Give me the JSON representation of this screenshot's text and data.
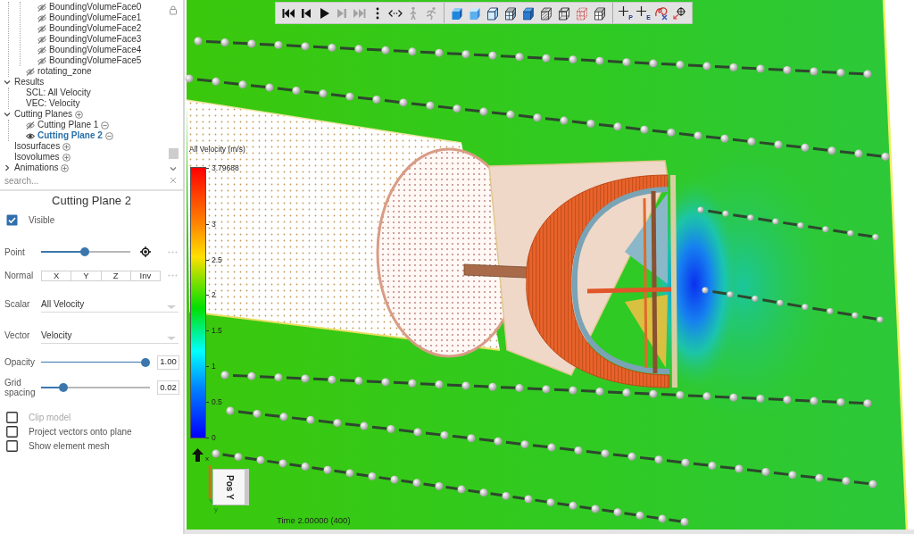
{
  "tree": {
    "items": [
      {
        "children": [
          {
            "children": [
              {
                "label": "BoundingVolumeFace0",
                "visible": false,
                "selected": false
              },
              {
                "label": "BoundingVolumeFace1",
                "visible": false,
                "selected": false
              },
              {
                "label": "BoundingVolumeFace2",
                "visible": false,
                "selected": false
              },
              {
                "label": "BoundingVolumeFace3",
                "visible": false,
                "selected": false
              },
              {
                "label": "BoundingVolumeFace4",
                "visible": false,
                "selected": false
              },
              {
                "label": "BoundingVolumeFace5",
                "visible": false,
                "selected": false
              }
            ]
          },
          {
            "label": "rotating_zone",
            "visible": false,
            "selected": false
          }
        ]
      },
      {
        "label": "Results",
        "expanded": true,
        "selected": false,
        "children": [
          {
            "label": "SCL: All Velocity",
            "selected": false
          },
          {
            "label": "VEC: Velocity",
            "selected": false
          }
        ]
      },
      {
        "label": "Cutting Planes",
        "expanded": true,
        "add_button": true,
        "selected": false,
        "children": [
          {
            "label": "Cutting Plane 1",
            "visible": false,
            "remove_button": true,
            "selected": false
          },
          {
            "label": "Cutting Plane 2",
            "visible": true,
            "remove_button": true,
            "selected": true
          }
        ]
      },
      {
        "label": "Isosurfaces",
        "add_button": true,
        "selected": false
      },
      {
        "label": "Isovolumes",
        "add_button": true,
        "selected": false
      },
      {
        "label": "Animations",
        "expanded": false,
        "add_button": true,
        "selected": false
      }
    ],
    "search": {
      "placeholder": "search..."
    }
  },
  "properties": {
    "title": "Cutting Plane 2",
    "visible": {
      "label": "Visible",
      "checked": true
    },
    "point": {
      "label": "Point",
      "level": 0.49
    },
    "normal": {
      "label": "Normal",
      "buttons": [
        "X",
        "Y",
        "Z",
        "Inv"
      ]
    },
    "scalar": {
      "label": "Scalar",
      "value": "All Velocity"
    },
    "vector": {
      "label": "Vector",
      "value": "Velocity"
    },
    "opacity": {
      "label": "Opacity",
      "level": 1,
      "value": "1.00"
    },
    "grid_spacing": {
      "label": "Grid spacing",
      "level": 0.18,
      "value": "0.02"
    },
    "options": [
      {
        "label": "Clip model",
        "checked": false,
        "disabled": true
      },
      {
        "label": "Project vectors onto plane",
        "checked": false,
        "disabled": false
      },
      {
        "label": "Show element mesh",
        "checked": false,
        "disabled": false
      }
    ]
  },
  "toolbar": {
    "groups": [
      [
        {
          "kind": "first",
          "disabled": false
        },
        {
          "kind": "previous",
          "disabled": false
        },
        {
          "kind": "play",
          "disabled": false
        },
        {
          "kind": "next",
          "disabled": true
        },
        {
          "kind": "last",
          "disabled": true
        },
        {
          "kind": "more",
          "disabled": false
        },
        {
          "kind": "bounce",
          "disabled": false
        },
        {
          "kind": "walk",
          "disabled": true
        },
        {
          "kind": "run",
          "disabled": true
        }
      ],
      [
        {
          "kind": "shaded",
          "disabled": false
        },
        {
          "kind": "smooth",
          "disabled": false
        },
        {
          "kind": "edged",
          "disabled": false
        },
        {
          "kind": "meshed",
          "disabled": false
        },
        {
          "kind": "flat",
          "disabled": false
        },
        {
          "kind": "hatched",
          "disabled": false
        },
        {
          "kind": "wire",
          "disabled": false
        },
        {
          "kind": "dashed",
          "disabled": false
        },
        {
          "kind": "grid",
          "disabled": false
        }
      ],
      [
        {
          "kind": "probe",
          "label": "P",
          "disabled": false
        },
        {
          "kind": "probe",
          "label": "E",
          "disabled": false
        },
        {
          "kind": "scribble",
          "disabled": false
        },
        {
          "kind": "center",
          "disabled": false
        }
      ]
    ]
  },
  "viewport": {
    "legend": {
      "title": "All Velocity (m/s)",
      "labels": [
        "3.79688",
        "3",
        "2.5",
        "2",
        "1.5",
        "1",
        "0.5",
        "0"
      ]
    },
    "orientation": {
      "face": "Pos Y",
      "axes": [
        "x",
        "y"
      ]
    },
    "time": "Time 2.00000 (400)"
  }
}
